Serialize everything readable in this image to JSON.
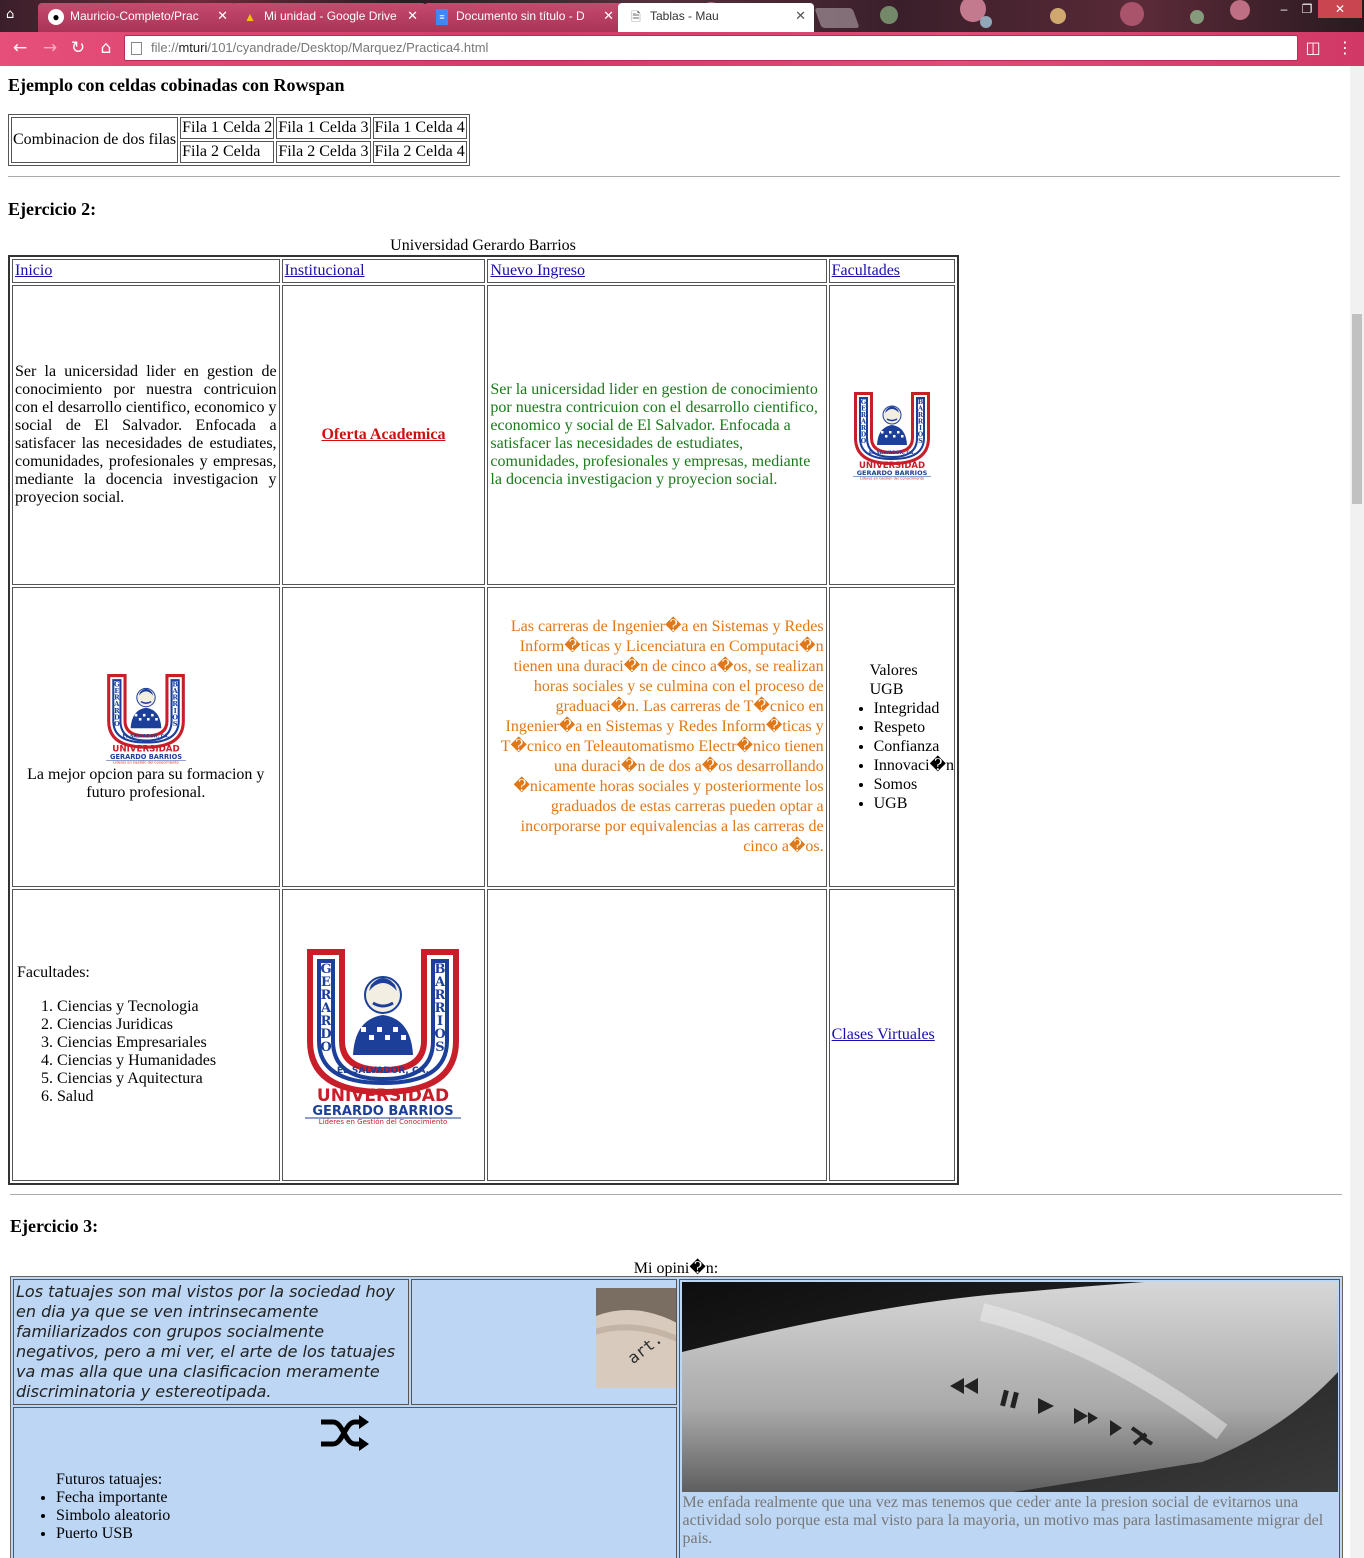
{
  "browser": {
    "tabs": [
      {
        "label": "Mauricio-Completo/Prac",
        "icon": "github-icon"
      },
      {
        "label": "Mi unidad - Google Drive",
        "icon": "google-drive-icon"
      },
      {
        "label": "Documento sin título - D",
        "icon": "google-docs-icon"
      },
      {
        "label": "Tablas - Mau",
        "icon": "page-icon",
        "active": true
      }
    ],
    "url_prefix": "file://",
    "url_host": "mturi",
    "url_path": "/101/cyandrade/Desktop/Marquez/Practica4.html"
  },
  "section1": {
    "heading": "Ejemplo con celdas cobinadas con Rowspan",
    "cells": {
      "merged": "Combinacion de dos filas",
      "r1c2": "Fila 1 Celda 2",
      "r1c3": "Fila 1 Celda 3",
      "r1c4": "Fila 1 Celda 4",
      "r2c2": "Fila 2 Celda",
      "r2c3": "Fila 2 Celda 3",
      "r2c4": "Fila 2 Celda 4"
    }
  },
  "section2": {
    "heading": "Ejercicio 2:",
    "caption": "Universidad Gerardo Barrios",
    "nav": [
      "Inicio",
      "Institucional",
      "Nuevo Ingreso",
      "Facultades"
    ],
    "mission_black": "Ser la unicersidad lider en gestion de conocimiento por nuestra contricuion con el desarrollo cientifico, economico y social de El Salvador. Enfocada a satisfacer las necesidades de estudiates, comunidades, profesionales y empresas, mediante la docencia investigacion y proyecion social.",
    "oferta": "Oferta Academica",
    "mission_green": "Ser la unicersidad lider en gestion de conocimiento por nuestra contricuion con el desarrollo cientifico, economico y social de El Salvador. Enfocada a satisfacer las necesidades de estudiates, comunidades, profesionales y empresas, mediante la docencia investigacion y proyecion social.",
    "logo_text": {
      "left": "GERARDO",
      "right": "BARRIOS",
      "country": "EL SALVADOR, CA.",
      "uni": "UNIVERSIDAD",
      "name": "GERARDO BARRIOS",
      "tag": "Líderes en Gestión del Conocimiento"
    },
    "best_option": "La mejor opcion para su formacion y futuro profesional.",
    "careers": "Las carreras de Ingenier�a en Sistemas y Redes Inform�ticas y Licenciatura en Computaci�n tienen una duraci�n de cinco a�os, se realizan horas sociales y se culmina con el proceso de graduaci�n. Las carreras de T�cnico en Ingenier�a en Sistemas y Redes Inform�ticas y T�cnico en Teleautomatismo Electr�nico tienen una duraci�n de dos a�os desarrollando �nicamente horas sociales y posteriormente los graduados de estas carreras pueden optar a incorporarse por equivalencias a las carreras de cinco a�os.",
    "values_title": "Valores UGB",
    "values": [
      "Integridad",
      "Respeto",
      "Confianza",
      "Innovaci�n",
      "Somos",
      "UGB"
    ],
    "faculties_title": "Facultades:",
    "faculties": [
      "Ciencias y Tecnologia",
      "Ciencias Juridicas",
      "Ciencias Empresariales",
      "Ciencias y Humanidades",
      "Ciencias y Aquitectura",
      "Salud"
    ],
    "virtual": "Clases Virtuales"
  },
  "section3": {
    "heading": "Ejercicio 3:",
    "caption": "Mi opini�n:",
    "opinion": "Los tatuajes son mal vistos por la sociedad hoy en dia ya que se ven intrinsecamente familiarizados con grupos socialmente negativos, pero a mi ver, el arte de los tatuajes va mas alla que una clasificacion meramente discriminatoria y estereotipada.",
    "tattoo_word": "art.",
    "future_title": "Futuros tatuajes:",
    "future": [
      "Fecha importante",
      "Simbolo aleatorio",
      "Puerto USB"
    ],
    "rant": "Me enfada realmente que una vez mas tenemos que ceder ante la presion social de evitarnos una actividad solo porque esta mal visto para la mayoria, un motivo mas para lastimasamente migrar del pais.",
    "cell_bg": "#bcd6f3"
  },
  "colors": {
    "tab_pink": "#d43a68",
    "link": "#1a0dab",
    "green": "#1a7a1a",
    "orange": "#e07818",
    "red": "#cc0000"
  }
}
